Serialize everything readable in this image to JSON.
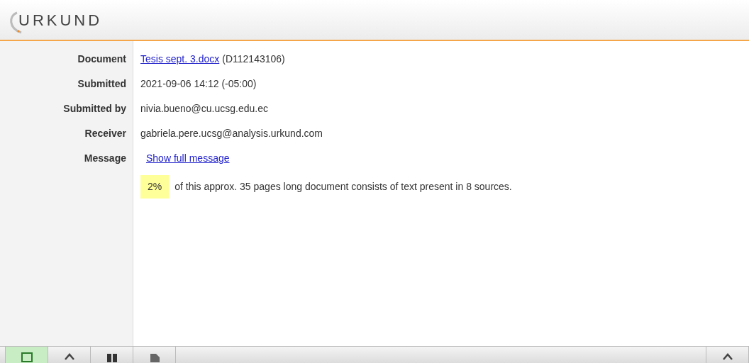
{
  "header": {
    "logo": "URKUND"
  },
  "details": [
    {
      "label": "Document",
      "kind": "document",
      "link": "Tesis sept. 3.docx",
      "value": "(D112143106)"
    },
    {
      "label": "Submitted",
      "kind": "text",
      "value": "2021-09-06 14:12 (-05:00)"
    },
    {
      "label": "Submitted by",
      "kind": "text",
      "value": "nivia.bueno@cu.ucsg.edu.ec"
    },
    {
      "label": "Receiver",
      "kind": "text",
      "value": "gabriela.pere.ucsg@analysis.urkund.com"
    },
    {
      "label": "Message",
      "kind": "link",
      "link": "Show full message"
    }
  ],
  "summary": {
    "percent": "2%",
    "text": "of this approx. 35 pages long document consists of text present in 8 sources."
  },
  "toolbar": {
    "buttons": [
      {
        "kind": "table",
        "selected": true
      },
      {
        "kind": "up",
        "selected": false
      },
      {
        "kind": "columns",
        "selected": false
      },
      {
        "kind": "document",
        "selected": false
      }
    ],
    "right_buttons": [
      {
        "kind": "up",
        "selected": false
      }
    ]
  }
}
